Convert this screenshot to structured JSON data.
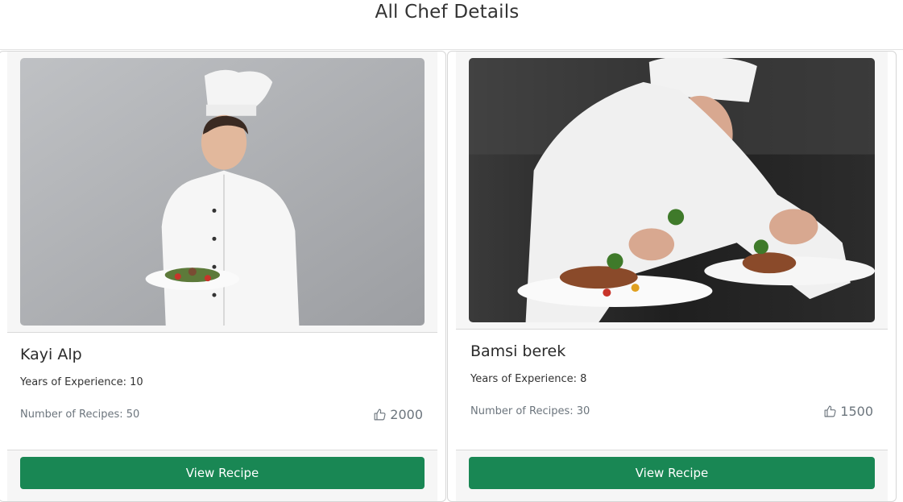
{
  "page": {
    "title": "All Chef Details"
  },
  "chefs": [
    {
      "name": "Kayi Alp",
      "experience": "Years of Experience: 10",
      "recipes": "Number of Recipes: 50",
      "likes": "2000",
      "button_label": "View Recipe",
      "like_icon": "thumbs-up-icon"
    },
    {
      "name": "Bamsi berek",
      "experience": "Years of Experience: 8",
      "recipes": "Number of Recipes: 30",
      "likes": "1500",
      "button_label": "View Recipe",
      "like_icon": "thumbs-up-icon"
    }
  ],
  "colors": {
    "button": "#198754",
    "card_border": "#d6d6d6"
  }
}
